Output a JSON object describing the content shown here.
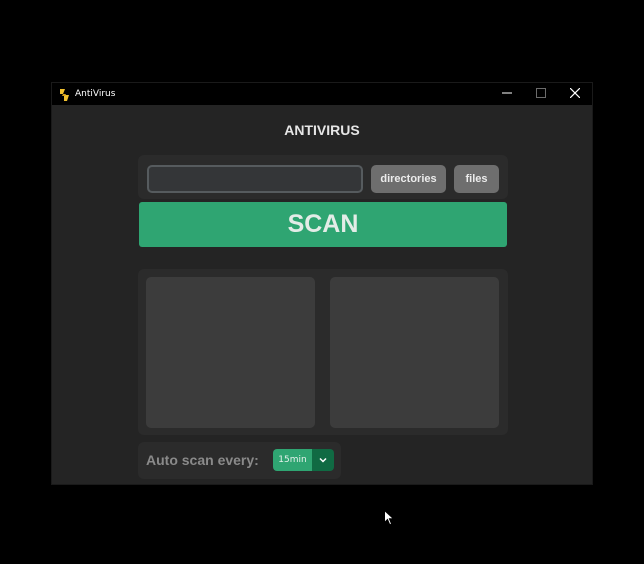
{
  "window": {
    "title": "AntiVirus",
    "icon": "antivirus-app-icon",
    "controls": [
      "minimize-icon",
      "maximize-icon",
      "close-icon"
    ]
  },
  "main": {
    "heading": "ANTIVIRUS",
    "path_input": {
      "value": "",
      "placeholder": ""
    },
    "directories_label": "directories",
    "files_label": "files",
    "scan_label": "SCAN",
    "auto_scan": {
      "label": "Auto scan every:",
      "selected": "15min",
      "arrow_icon": "chevron-down-icon"
    }
  },
  "colors": {
    "accent": "#2fa572",
    "accent_dark": "#106a43",
    "window_bg": "#242424",
    "frame_bg": "#2b2b2b",
    "panel_bg": "#3c3c3c",
    "button_gray": "#6e6e6e"
  }
}
